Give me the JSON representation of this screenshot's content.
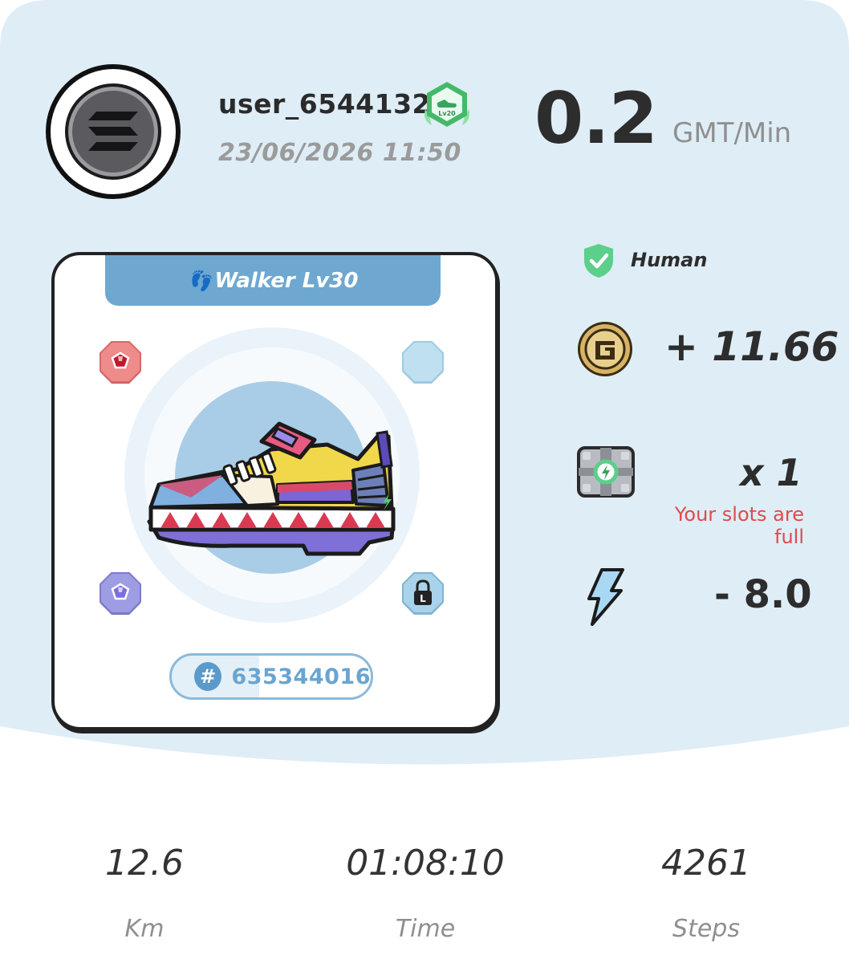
{
  "profile": {
    "username": "user_6544132",
    "datetime": "23/06/2026 11:50",
    "level_badge": "Lv20"
  },
  "rate": {
    "value": "0.2",
    "unit": "GMT/Min"
  },
  "sneaker": {
    "type_label": "Walker Lv30",
    "id": "635344016",
    "gem_slots": [
      "red-gem-slot",
      "empty-slot",
      "purple-gem-slot",
      "locked-slot"
    ]
  },
  "stats": {
    "verified_label": "Human",
    "earned": "+ 11.66",
    "mystery_box_count": "x 1",
    "slots_message": "Your slots are full",
    "energy": "- 8.0"
  },
  "summary": [
    {
      "value": "12.6",
      "label": "Km"
    },
    {
      "value": "01:08:10",
      "label": "Time"
    },
    {
      "value": "4261",
      "label": "Steps"
    }
  ],
  "colors": {
    "background": "#dfedf6",
    "tab": "#6ea8d0",
    "accent_blue": "#5b9bcb",
    "warning_red": "#e14a4a",
    "verified_green": "#5ccf8a",
    "coin_gold": "#d8b363"
  }
}
